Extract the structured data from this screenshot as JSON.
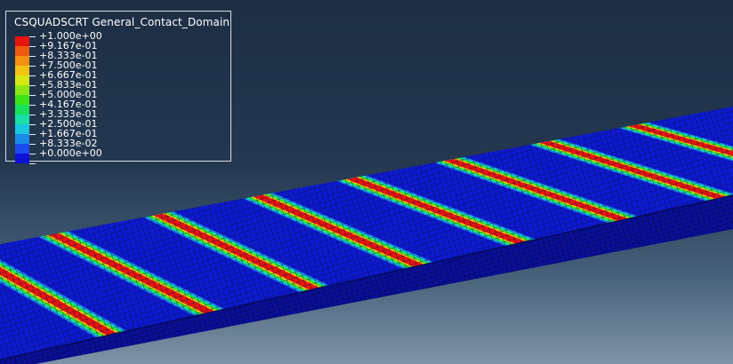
{
  "legend": {
    "title": "CSQUADSCRT General_Contact_Domain",
    "labels": [
      "+1.000e+00",
      "+9.167e-01",
      "+8.333e-01",
      "+7.500e-01",
      "+6.667e-01",
      "+5.833e-01",
      "+5.000e-01",
      "+4.167e-01",
      "+3.333e-01",
      "+2.500e-01",
      "+1.667e-01",
      "+8.333e-02",
      "+0.000e+00"
    ],
    "colors": [
      "#e8140f",
      "#ee5a10",
      "#f29012",
      "#f2c312",
      "#d6e814",
      "#8ce815",
      "#3ee31a",
      "#18e05a",
      "#18e0a8",
      "#19c6e0",
      "#1a8ae8",
      "#1a4cf0",
      "#0d12d8"
    ]
  },
  "model": {
    "base_color": "#0e1ad0",
    "contact_color": "#e8140f",
    "stripe_count": 8
  }
}
